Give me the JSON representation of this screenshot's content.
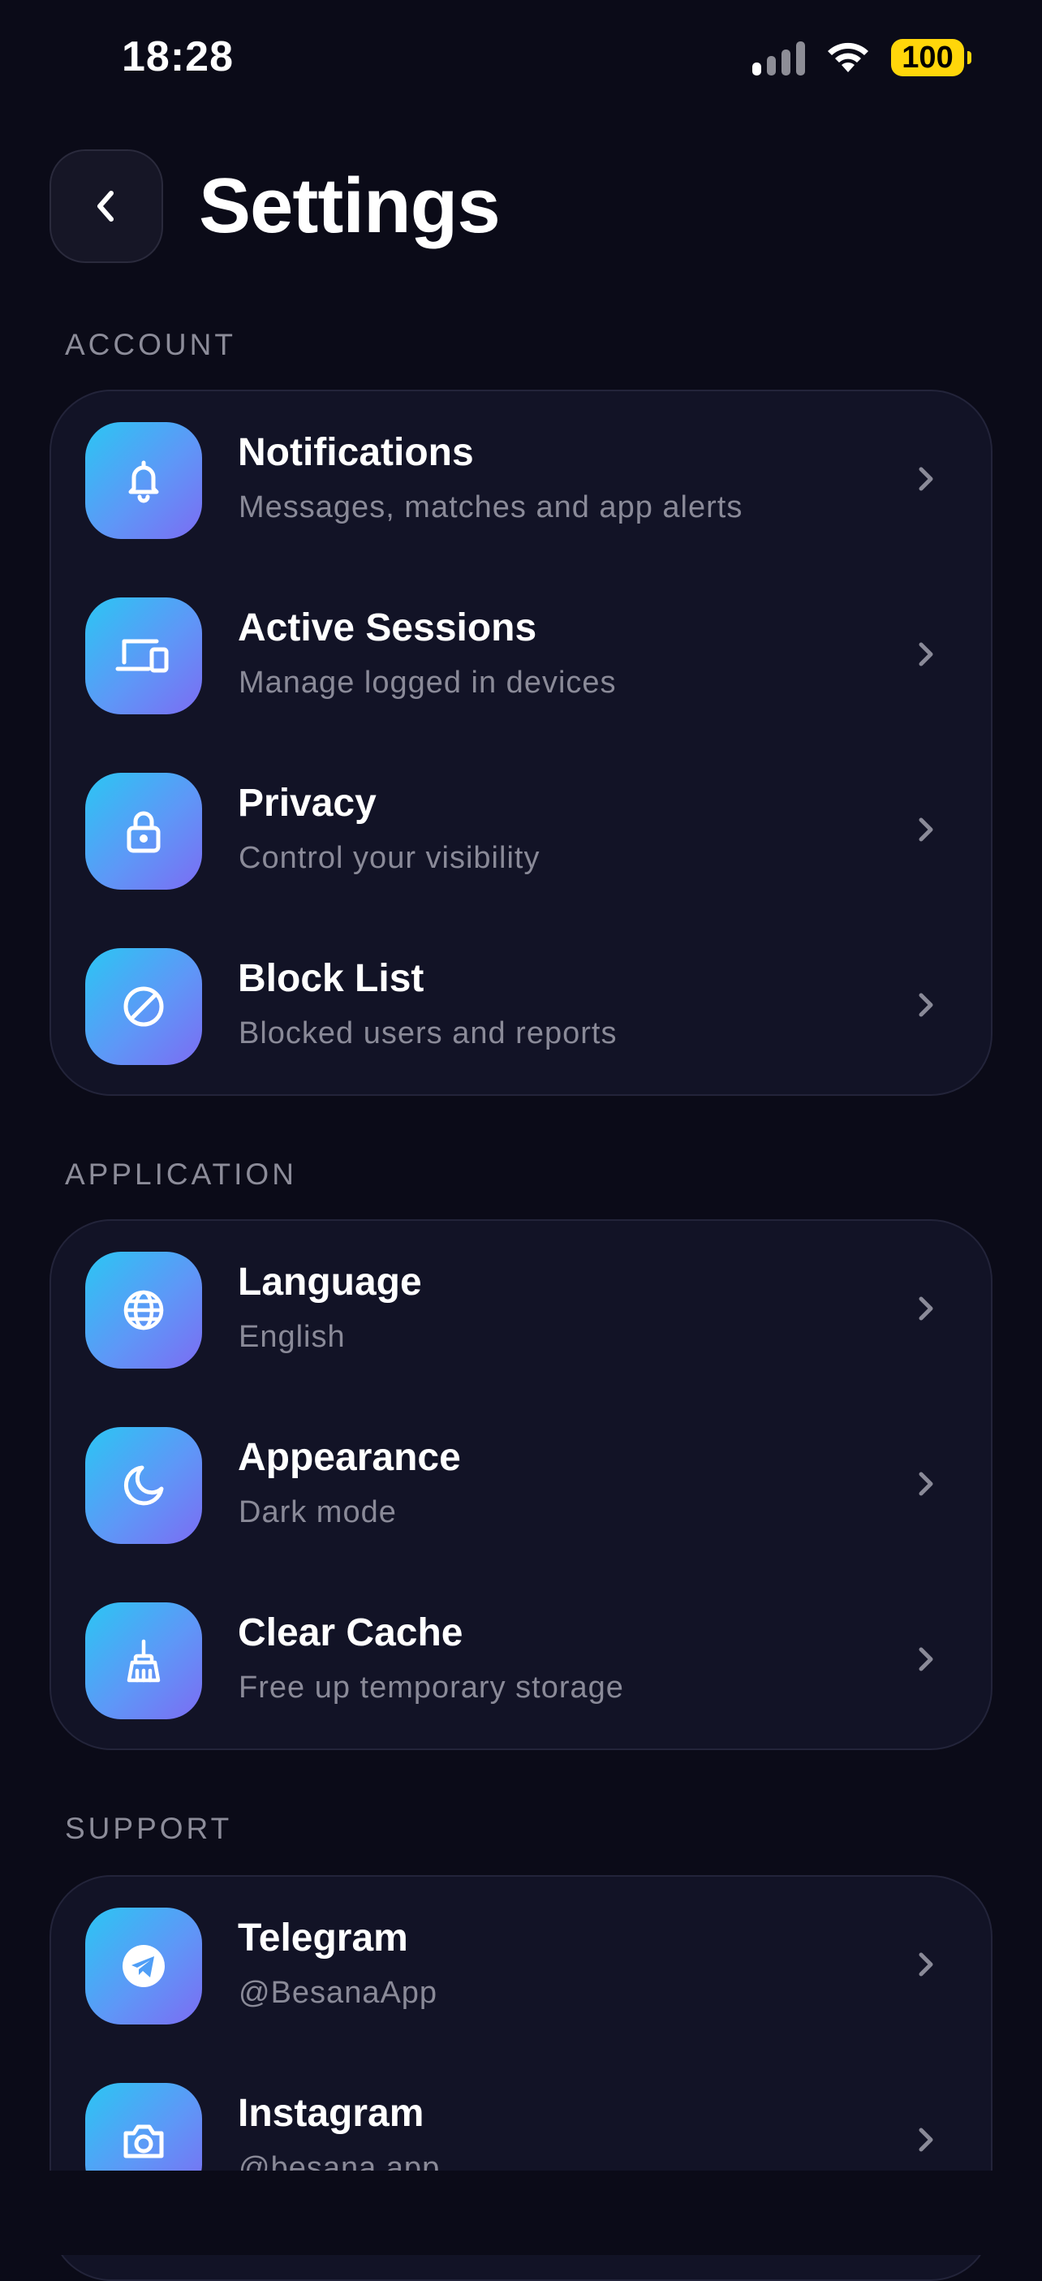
{
  "status_bar": {
    "time": "18:28",
    "battery": "100"
  },
  "header": {
    "title": "Settings",
    "back_icon": "chevron-left-icon"
  },
  "sections": [
    {
      "label": "ACCOUNT",
      "items": [
        {
          "title": "Notifications",
          "subtitle": "Messages, matches and app alerts",
          "icon": "bell-icon"
        },
        {
          "title": "Active Sessions",
          "subtitle": "Manage logged in devices",
          "icon": "devices-icon"
        },
        {
          "title": "Privacy",
          "subtitle": "Control your visibility",
          "icon": "lock-icon"
        },
        {
          "title": "Block List",
          "subtitle": "Blocked users and reports",
          "icon": "block-icon"
        }
      ]
    },
    {
      "label": "APPLICATION",
      "items": [
        {
          "title": "Language",
          "subtitle": "English",
          "icon": "globe-icon"
        },
        {
          "title": "Appearance",
          "subtitle": "Dark mode",
          "icon": "moon-icon"
        },
        {
          "title": "Clear Cache",
          "subtitle": "Free up temporary storage",
          "icon": "broom-icon"
        }
      ]
    },
    {
      "label": "SUPPORT",
      "items": [
        {
          "title": "Telegram",
          "subtitle": "@BesanaApp",
          "icon": "telegram-icon"
        },
        {
          "title": "Instagram",
          "subtitle": "@besana.app",
          "icon": "camera-icon"
        }
      ]
    }
  ],
  "colors": {
    "background": "#0b0b18",
    "card": "#121326",
    "accent_start": "#2bc6f3",
    "accent_end": "#7c6cf3",
    "battery": "#ffd60a"
  }
}
